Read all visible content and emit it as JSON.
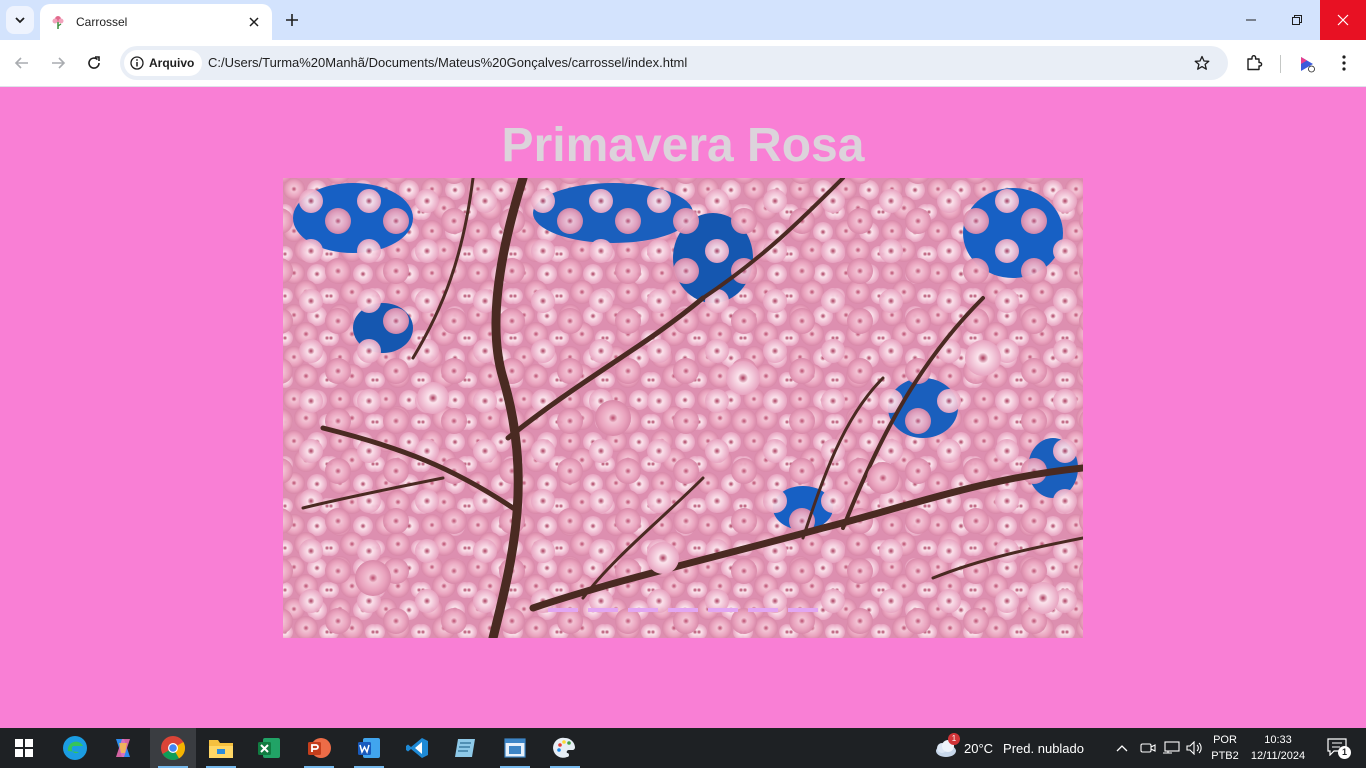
{
  "browser": {
    "tab_title": "Carrossel",
    "site_chip_label": "Arquivo",
    "url": "C:/Users/Turma%20Manhã/Documents/Mateus%20Gonçalves/carrossel/index.html",
    "icons": {
      "tab_search": "chevron-down-icon",
      "favicon": "flower-icon",
      "tab_close": "close-icon",
      "new_tab": "plus-icon",
      "back": "arrow-left-icon",
      "forward": "arrow-right-icon",
      "reload": "reload-icon",
      "site_info": "info-icon",
      "bookmark": "star-icon",
      "extensions": "puzzle-icon",
      "profile": "profile-icon",
      "menu": "kebab-menu-icon"
    }
  },
  "page": {
    "title": "Primavera Rosa",
    "background_color": "#f97fd5",
    "title_color": "#dcd3db",
    "carousel": {
      "image_subject": "cherry-blossom-branches",
      "indicator_count": 7,
      "active_index": 0,
      "indicator_color": "#e2a6f2"
    }
  },
  "taskbar": {
    "apps": [
      "start",
      "edge",
      "copilot",
      "chrome",
      "file-explorer",
      "excel",
      "powerpoint",
      "word",
      "vscode",
      "notepad",
      "window-app",
      "paint"
    ],
    "active_app": "chrome",
    "weather": {
      "temperature": "20°C",
      "condition": "Pred. nublado",
      "badge": "1"
    },
    "language_line1": "POR",
    "language_line2": "PTB2",
    "time": "10:33",
    "date": "12/11/2024",
    "notification_count": "1"
  }
}
